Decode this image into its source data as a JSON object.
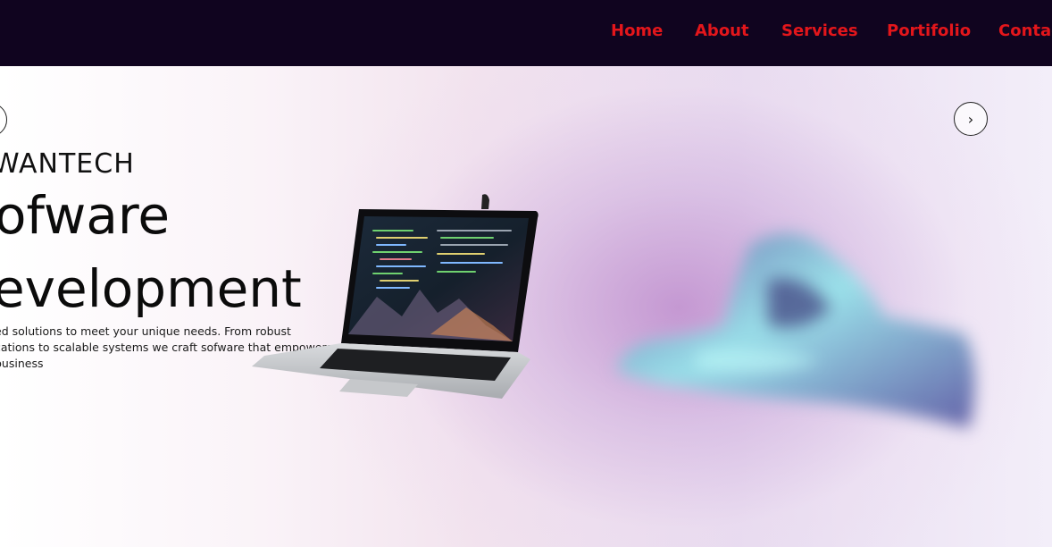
{
  "nav": {
    "items": [
      {
        "label": "Home"
      },
      {
        "label": "About"
      },
      {
        "label": "Services"
      },
      {
        "label": "Portifolio"
      },
      {
        "label": "Contact"
      }
    ]
  },
  "hero": {
    "brand": "WANTECH",
    "headline_line1": "ofware",
    "headline_line2": "evelopment",
    "description": "ed solutions to meet your unique needs. From robust cations to scalable systems we craft sofware that empowers business",
    "prev_symbol": "‹",
    "next_symbol": "›"
  },
  "colors": {
    "nav_background": "#10041f",
    "nav_link": "#e3161b",
    "hero_glow": "#c89ad3"
  },
  "icons": [
    "chevron-left-icon",
    "chevron-right-icon",
    "laptop-image",
    "hand-image"
  ]
}
